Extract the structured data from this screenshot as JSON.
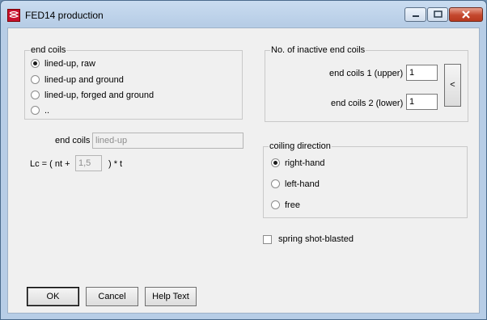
{
  "window": {
    "title": "FED14 production"
  },
  "end_coils_group": {
    "legend": "end coils",
    "options": [
      {
        "label": "lined-up, raw",
        "selected": true
      },
      {
        "label": "lined-up and ground",
        "selected": false
      },
      {
        "label": "lined-up, forged and ground",
        "selected": false
      },
      {
        "label": "..",
        "selected": false
      }
    ]
  },
  "end_coils_field": {
    "label": "end coils",
    "value": "lined-up"
  },
  "lc_formula": {
    "prefix": "Lc = ( nt +",
    "value": "1,5",
    "suffix": ") * t"
  },
  "inactive_group": {
    "legend": "No. of inactive end coils",
    "upper_label": "end coils 1 (upper)",
    "upper_value": "1",
    "lower_label": "end coils 2 (lower)",
    "lower_value": "1",
    "arrow_label": "<"
  },
  "coiling_group": {
    "legend": "coiling direction",
    "options": [
      {
        "label": "right-hand",
        "selected": true
      },
      {
        "label": "left-hand",
        "selected": false
      },
      {
        "label": "free",
        "selected": false
      }
    ]
  },
  "shot_blasted": {
    "label": "spring shot-blasted",
    "checked": false
  },
  "buttons": {
    "ok": "OK",
    "cancel": "Cancel",
    "help": "Help Text"
  },
  "icons": {
    "app": "spring-coil-icon",
    "minimize": "minimize-icon",
    "maximize": "maximize-icon",
    "close": "close-icon"
  }
}
